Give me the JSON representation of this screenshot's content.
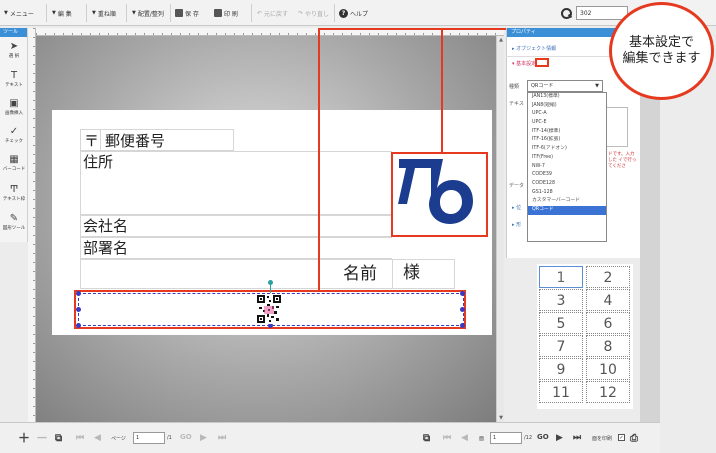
{
  "toolbar": {
    "menu_label": "メニュー",
    "edit_label": "編 集",
    "stack_label": "重ね順",
    "arrange_label": "配置/整列",
    "save_label": "保 存",
    "print_label": "印 刷",
    "undo_label": "元に戻す",
    "redo_label": "やり直し",
    "help_label": "ヘルプ",
    "zoom_value": "302"
  },
  "tools": {
    "header": "ツール",
    "items": [
      {
        "label": "選 択",
        "icon": "cursor-icon"
      },
      {
        "label": "テキスト",
        "icon": "text-icon"
      },
      {
        "label": "画像挿入",
        "icon": "image-icon"
      },
      {
        "label": "チェック",
        "icon": "check-icon"
      },
      {
        "label": "バーコード",
        "icon": "barcode-icon"
      },
      {
        "label": "テキスト枠",
        "icon": "text-frame-icon"
      },
      {
        "label": "図形ツール",
        "icon": "shape-icon"
      }
    ]
  },
  "card": {
    "postal_mark": "〒",
    "postal_label": "郵便番号",
    "address_label": "住所",
    "company_label": "会社名",
    "department_label": "部署名",
    "name_label": "名前",
    "honorific": "様"
  },
  "properties": {
    "header": "プロパティ",
    "object_info": "オブジェクト情報",
    "basic_settings": "基本設定",
    "type_label": "種類",
    "selected_type": "QRコード",
    "text_label": "テキス",
    "data_label": "データ",
    "position_label": "位",
    "shape_label": "形",
    "red_note": "ドです。入力した イで行ってくださ",
    "barcode_types": [
      "JAN13(標準)",
      "JAN8(短縮)",
      "UPC-A",
      "UPC-E",
      "ITF-14(標準)",
      "ITF-16(拡張)",
      "ITF-6(アドオン)",
      "ITF(Free)",
      "NW-7",
      "CODE39",
      "CODE128",
      "GS1-128",
      "カスタマーバーコード",
      "QRコード"
    ]
  },
  "page_grid": [
    "1",
    "2",
    "3",
    "4",
    "5",
    "6",
    "7",
    "8",
    "9",
    "10",
    "11",
    "12"
  ],
  "bottom": {
    "page_label": "ページ",
    "page_value": "1",
    "page_total": "/1",
    "go_label": "GO",
    "sheet_label": "面",
    "sheet_value": "1",
    "sheet_total": "/12",
    "print_face_label": "面を印刷"
  },
  "callout": {
    "line1": "基本設定で",
    "line2": "編集できます"
  },
  "colors": {
    "accent_blue": "#3b8fd6",
    "callout_red": "#e53a20",
    "selection_blue": "#3b73d4"
  }
}
